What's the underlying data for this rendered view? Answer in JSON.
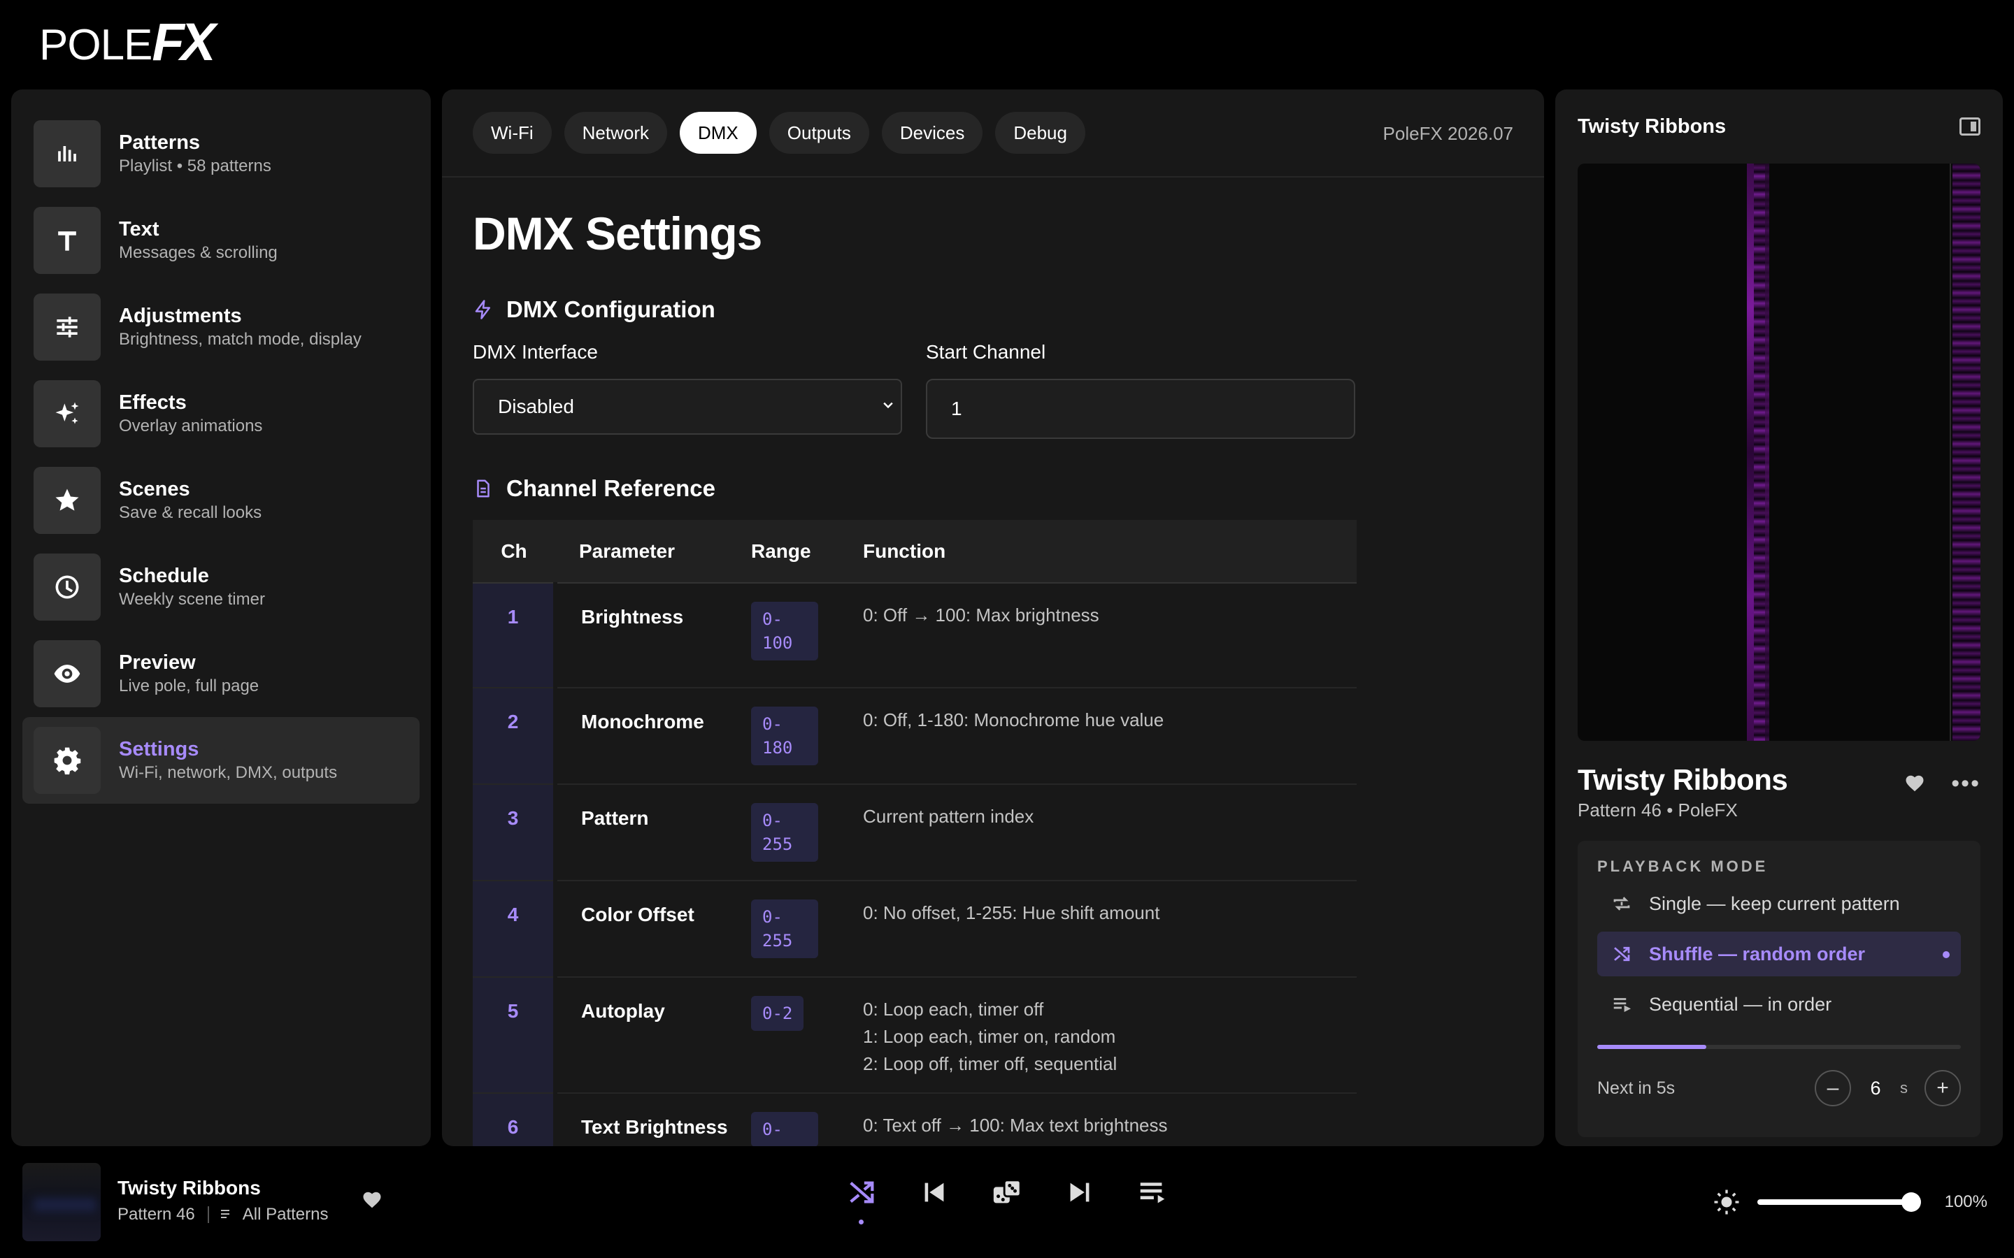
{
  "app": {
    "logo": "POLEFX",
    "logo_main": "POLE",
    "logo_fx": "FX"
  },
  "sidebar": {
    "items": [
      {
        "title": "Patterns",
        "subtitle": "Playlist • 58 patterns",
        "icon": "bar-chart-icon"
      },
      {
        "title": "Text",
        "subtitle": "Messages & scrolling",
        "icon": "text-icon"
      },
      {
        "title": "Adjustments",
        "subtitle": "Brightness, match mode, display",
        "icon": "sliders-icon"
      },
      {
        "title": "Effects",
        "subtitle": "Overlay animations",
        "icon": "sparkle-icon"
      },
      {
        "title": "Scenes",
        "subtitle": "Save & recall looks",
        "icon": "star-icon"
      },
      {
        "title": "Schedule",
        "subtitle": "Weekly scene timer",
        "icon": "clock-icon"
      },
      {
        "title": "Preview",
        "subtitle": "Live pole, full page",
        "icon": "eye-icon"
      },
      {
        "title": "Settings",
        "subtitle": "Wi-Fi, network, DMX, outputs",
        "icon": "gear-icon",
        "active": true
      }
    ]
  },
  "tabs": [
    "Wi-Fi",
    "Network",
    "DMX",
    "Outputs",
    "Devices",
    "Debug"
  ],
  "active_tab": "DMX",
  "version": "PoleFX 2026.07",
  "main": {
    "title": "DMX Settings",
    "config_section": "DMX Configuration",
    "interface_label": "DMX Interface",
    "interface_value": "Disabled",
    "start_channel_label": "Start Channel",
    "start_channel_value": "1",
    "reference_section": "Channel Reference",
    "table": {
      "headers": [
        "Ch",
        "Parameter",
        "Range",
        "Function"
      ],
      "rows": [
        {
          "ch": "1",
          "param": "Brightness",
          "range_a": "0-",
          "range_b": "100",
          "func": [
            "0: Off → 100: Max brightness"
          ]
        },
        {
          "ch": "2",
          "param": "Monochrome",
          "range_a": "0-",
          "range_b": "180",
          "func": [
            "0: Off, 1-180: Monochrome hue value"
          ]
        },
        {
          "ch": "3",
          "param": "Pattern",
          "range_a": "0-",
          "range_b": "255",
          "func": [
            "Current pattern index"
          ]
        },
        {
          "ch": "4",
          "param": "Color Offset",
          "range_a": "0-",
          "range_b": "255",
          "func": [
            "0: No offset, 1-255: Hue shift amount"
          ]
        },
        {
          "ch": "5",
          "param": "Autoplay",
          "range_a": "0-2",
          "range_b": "",
          "func": [
            "0: Loop each, timer off",
            "1: Loop each, timer on, random",
            "2: Loop off, timer off, sequential"
          ]
        },
        {
          "ch": "6",
          "param": "Text Brightness",
          "range_a": "0-",
          "range_b": "",
          "func": [
            "0: Text off → 100: Max text brightness"
          ]
        }
      ]
    }
  },
  "right_panel": {
    "header": "Twisty Ribbons",
    "title": "Twisty Ribbons",
    "subtitle": "Pattern 46 • PoleFX",
    "playback_label": "PLAYBACK MODE",
    "options": [
      {
        "label": "Single — keep current pattern",
        "icon": "repeat-icon"
      },
      {
        "label": "Shuffle — random order",
        "icon": "shuffle-icon",
        "active": true
      },
      {
        "label": "Sequential — in order",
        "icon": "list-icon"
      }
    ],
    "progress": 0.3,
    "next_label": "Next in 5s",
    "timer_value": "6",
    "timer_unit": "s"
  },
  "now_playing": {
    "title": "Twisty Ribbons",
    "pattern": "Pattern 46",
    "playlist": "All Patterns"
  },
  "volume": {
    "label": "100%",
    "level": 1.0
  },
  "colors": {
    "accent": "#a78bfa",
    "background": "#000000",
    "panel": "#181818"
  }
}
